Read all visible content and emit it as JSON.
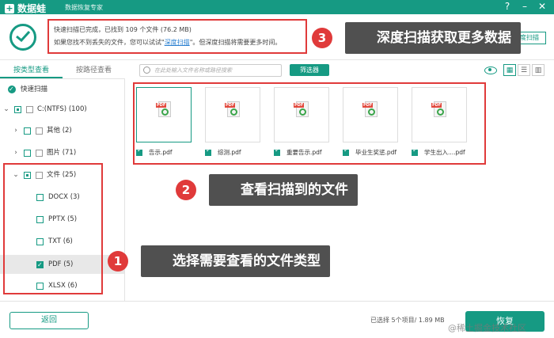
{
  "app": {
    "name": "数据蛙",
    "subtitle": "数据恢复专家"
  },
  "window": {
    "help_icon": "help-icon",
    "min_icon": "minimize-icon",
    "close_icon": "close-icon"
  },
  "scan": {
    "line1": "快速扫描已完成，已找到 109 个文件 (76.2 MB)",
    "line2_prefix": "如果您找不到丢失的文件，您可以试试\"",
    "line2_link": "深度扫描",
    "line2_suffix": "\"。但深度扫描将需要更多时间。",
    "deep_button": "深度扫描"
  },
  "left_tabs": [
    "按类型查看",
    "按路径查看"
  ],
  "toolbar": {
    "search_placeholder": "在此处输入文件名称或路径搜索",
    "filter_label": "筛选器"
  },
  "tree": {
    "quick_scan": "快速扫描",
    "drive": "C:(NTFS) (100)",
    "other": "其他 (2)",
    "pictures": "图片 (71)",
    "documents": "文件 (25)",
    "docx": "DOCX (3)",
    "pptx": "PPTX (5)",
    "txt": "TXT (6)",
    "pdf": "PDF (5)",
    "xlsx": "XLSX (6)"
  },
  "files": [
    "告示.pdf",
    "综测.pdf",
    "重要告示.pdf",
    "毕业生奖惩.pdf",
    "学生出入....pdf"
  ],
  "callouts": {
    "c1_num": "1",
    "c1_text": "选择需要查看的文件类型",
    "c2_num": "2",
    "c2_text": "查看扫描到的文件",
    "c3_num": "3",
    "c3_text": "深度扫描获取更多数据"
  },
  "footer": {
    "back": "返回",
    "selection": "已选择 5个项目/ 1.89 MB",
    "recover": "恢复",
    "watermark": "@稀土掘金技术社区"
  },
  "colors": {
    "brand": "#169a83",
    "annotation": "#e03a3a",
    "callout_bg": "#505050"
  }
}
